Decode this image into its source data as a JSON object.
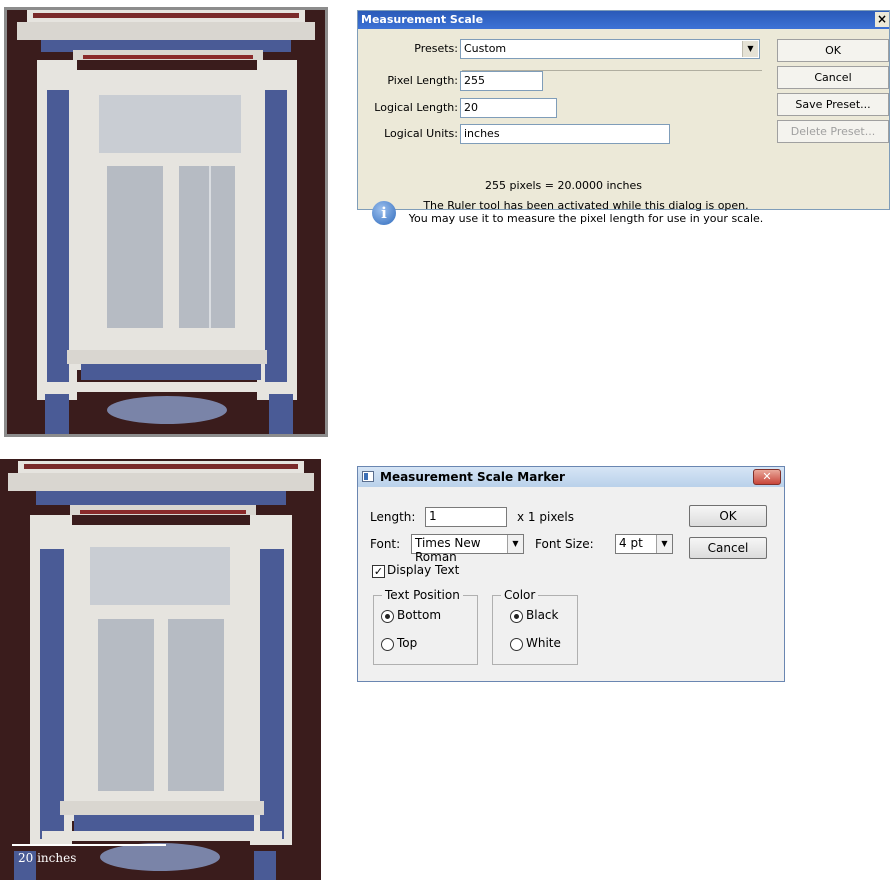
{
  "top_dialog": {
    "title": "Measurement Scale",
    "close_glyph": "×",
    "presets_label": "Presets:",
    "presets_value": "Custom",
    "pixel_length_label": "Pixel Length:",
    "pixel_length_value": "255",
    "logical_length_label": "Logical Length:",
    "logical_length_value": "20",
    "logical_units_label": "Logical Units:",
    "logical_units_value": "inches",
    "summary": "255 pixels = 20.0000 inches",
    "info_line1": "The Ruler tool has been activated while this dialog is open.",
    "info_line2": "You may use it to measure the pixel length for use in your scale.",
    "buttons": {
      "ok": "OK",
      "cancel": "Cancel",
      "save_preset": "Save Preset...",
      "delete_preset": "Delete Preset..."
    },
    "icon": "info-icon"
  },
  "bottom_dialog": {
    "title": "Measurement Scale Marker",
    "close_glyph": "✕",
    "length_label": "Length:",
    "length_value": "1",
    "length_suffix": "x 1 pixels",
    "font_label": "Font:",
    "font_value": "Times New Roman",
    "font_size_label": "Font Size:",
    "font_size_value": "4 pt",
    "display_text_label": "Display Text",
    "display_text_checked": true,
    "text_position": {
      "legend": "Text Position",
      "bottom": "Bottom",
      "top": "Top",
      "selected": "Bottom"
    },
    "color": {
      "legend": "Color",
      "black": "Black",
      "white": "White",
      "selected": "Black"
    },
    "buttons": {
      "ok": "OK",
      "cancel": "Cancel"
    }
  },
  "scale_marker_label": "20 inches",
  "colors": {
    "wall": "#3a1c1c",
    "trim_blue": "#4a5b96",
    "trim_white": "#e6e4df",
    "lace": "#c9cdd3"
  }
}
